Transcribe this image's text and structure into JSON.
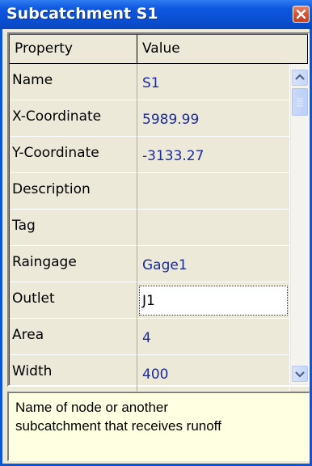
{
  "window": {
    "title": "Subcatchment S1"
  },
  "grid": {
    "headers": {
      "property": "Property",
      "value": "Value"
    },
    "rows": [
      {
        "property": "Name",
        "value": "S1"
      },
      {
        "property": "X-Coordinate",
        "value": "5989.99"
      },
      {
        "property": "Y-Coordinate",
        "value": "-3133.27"
      },
      {
        "property": "Description",
        "value": ""
      },
      {
        "property": "Tag",
        "value": ""
      },
      {
        "property": "Raingage",
        "value": "Gage1"
      },
      {
        "property": "Outlet",
        "value": "J1"
      },
      {
        "property": "Area",
        "value": "4"
      },
      {
        "property": "Width",
        "value": "400"
      }
    ],
    "editing_row": 6
  },
  "description": {
    "text_line1": "Name of node or another",
    "text_line2": "subcatchment that receives runoff"
  },
  "icons": {
    "close": "close-icon",
    "scroll_up": "scroll-up-arrow-icon",
    "scroll_down": "scroll-down-arrow-icon"
  },
  "colors": {
    "titlebar": "#0a4fd2",
    "value_text": "#1a2aa0",
    "panel_bg": "#ece9d8",
    "description_bg": "#ffffe1"
  }
}
